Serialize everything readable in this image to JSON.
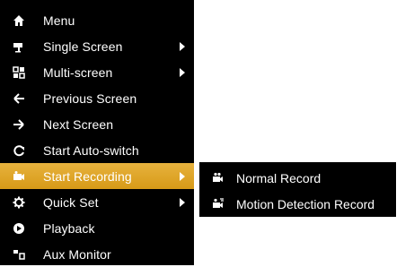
{
  "menu": {
    "items": [
      {
        "label": "Menu",
        "icon": "home-icon"
      },
      {
        "label": "Single Screen",
        "icon": "camera-icon",
        "submenu": true
      },
      {
        "label": "Multi-screen",
        "icon": "grid-icon",
        "submenu": true
      },
      {
        "label": "Previous Screen",
        "icon": "arrow-left-icon"
      },
      {
        "label": "Next Screen",
        "icon": "arrow-right-icon"
      },
      {
        "label": "Start Auto-switch",
        "icon": "refresh-icon"
      },
      {
        "label": "Start Recording",
        "icon": "record-icon",
        "submenu": true,
        "active": true
      },
      {
        "label": "Quick Set",
        "icon": "gear-icon",
        "submenu": true
      },
      {
        "label": "Playback",
        "icon": "playback-icon"
      },
      {
        "label": "Aux Monitor",
        "icon": "monitor-icon"
      }
    ]
  },
  "submenu": {
    "items": [
      {
        "label": "Normal Record",
        "icon": "normal-record-icon"
      },
      {
        "label": "Motion Detection Record",
        "icon": "motion-record-icon"
      }
    ]
  },
  "colors": {
    "menu_bg": "#000000",
    "active_highlight": "#e0a42a",
    "text": "#ffffff"
  }
}
